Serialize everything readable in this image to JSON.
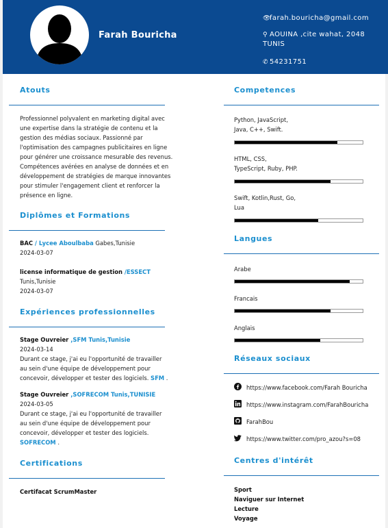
{
  "header": {
    "name": "Farah Bouricha",
    "email": "farah.bouricha@gmail.com",
    "address_line1": "AOUINA ,cite wahat, 2048",
    "address_line2": "TUNIS",
    "phone": "54231751"
  },
  "atouts": {
    "title": "Atouts",
    "text": "Professionnel polyvalent en marketing digital avec une expertise dans la stratégie de contenu et la gestion des médias sociaux. Passionné par l'optimisation des campagnes publicitaires en ligne pour générer une croissance mesurable des revenus. Compétences avérées en analyse de données et en développement de stratégies de marque innovantes pour stimuler l'engagement client et renforcer la présence en ligne."
  },
  "diplomes": {
    "title": "Diplômes et Formations",
    "items": [
      {
        "degree": "BAC",
        "sep": " / ",
        "school": "Lycee Aboulbaba",
        "place": " Gabes,Tunisie",
        "date": "2024-03-07"
      },
      {
        "degree": "license informatique de gestion",
        "sep": " /",
        "school": "ESSECT",
        "place": "Tunis,Tunisie",
        "date": "2024-03-07"
      }
    ]
  },
  "experiences": {
    "title": "Expériences professionnelles",
    "items": [
      {
        "role": "Stage Ouvreier",
        "company": " ,SFM Tunis,Tunisie",
        "date": "2024-03-14",
        "desc": "Durant ce stage, j'ai eu l'opportunité de travailler au sein d'une équipe de développement pour concevoir, développer et tester des logiciels.",
        "tag": "SFM",
        "end": " ."
      },
      {
        "role": "Stage Ouvreier",
        "company": " ,SOFRECOM Tunis,TUNISIE",
        "date": "2024-03-05",
        "desc": "Durant ce stage, j'ai eu l'opportunité de travailler au sein d'une équipe de développement pour concevoir, développer et tester des logiciels.",
        "tag": "SOFRECOM",
        "end": " ."
      }
    ]
  },
  "certifications": {
    "title": "Certifications",
    "items": [
      "Certifacat ScrumMaster"
    ]
  },
  "competences": {
    "title": "Competences",
    "items": [
      {
        "line1": "Python, JavaScript,",
        "line2": "Java, C++, Swift.",
        "level": 0.8
      },
      {
        "line1": "HTML, CSS,",
        "line2": "TypeScript, Ruby, PHP.",
        "level": 0.75
      },
      {
        "line1": "Swift, Kotlin,Rust, Go,",
        "line2": "Lua",
        "level": 0.65
      }
    ]
  },
  "langues": {
    "title": "Langues",
    "items": [
      {
        "name": "Arabe",
        "level": 0.9
      },
      {
        "name": "Francais",
        "level": 0.75
      },
      {
        "name": "Anglais",
        "level": 0.67
      }
    ]
  },
  "reseaux": {
    "title": "Réseaux sociaux",
    "items": [
      {
        "icon": "facebook-icon",
        "text": "https://www.facebook.com/Farah Bouricha"
      },
      {
        "icon": "linkedin-icon",
        "text": "https://www.instagram.com/FarahBouricha"
      },
      {
        "icon": "github-icon",
        "text": "FarahBou"
      },
      {
        "icon": "twitter-icon",
        "text": "https://www.twitter.com/pro_azou?s=08"
      }
    ]
  },
  "interets": {
    "title": "Centres d'intérêt",
    "items": [
      "Sport",
      "Naviguer sur Internet",
      "Lecture",
      "Voyage"
    ]
  }
}
